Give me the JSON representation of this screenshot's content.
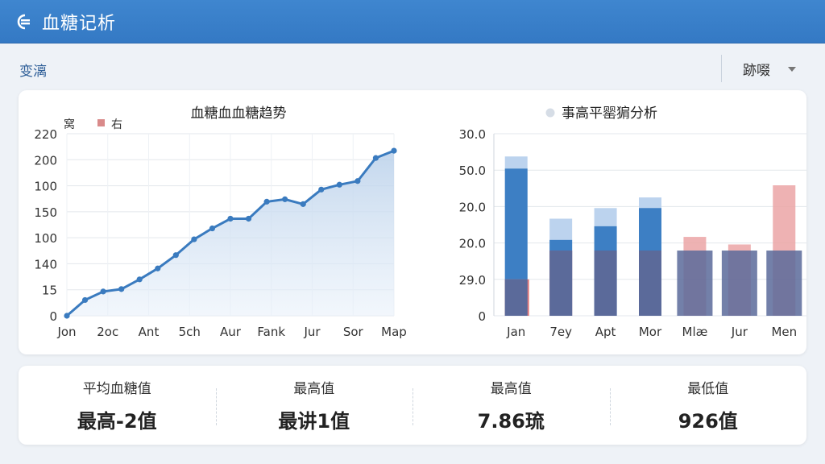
{
  "app": {
    "title": "血糖记析"
  },
  "toolbar": {
    "left_label": "变漓",
    "dropdown_label": "跡啜"
  },
  "charts": {
    "line": {
      "title": "血糖血血糖趋势",
      "legend_left": "窝",
      "legend_right": "右"
    },
    "bar": {
      "title": "事高平罂猏分析"
    }
  },
  "stats": [
    {
      "label": "平均血糖值",
      "value": "最高-2值"
    },
    {
      "label": "最高值",
      "value": "最讲1值"
    },
    {
      "label": "最高值",
      "value": "7.86琉"
    },
    {
      "label": "最低值",
      "value": "926值"
    }
  ],
  "colors": {
    "header": "#3a80c9",
    "line": "#3a7bbf",
    "bar_blue": "#3d7fc4",
    "bar_light_blue": "#bcd3ee",
    "bar_navy": "#5b6a9a",
    "bar_red": "#e07b7d",
    "bar_light_red": "#eba4a6"
  },
  "chart_data": [
    {
      "type": "area",
      "title": "血糖血血糖趋势",
      "categories": [
        "Jon",
        "2oc",
        "Ant",
        "5ch",
        "Aur",
        "Fank",
        "Jur",
        "Sor",
        "Map"
      ],
      "y_ticks": [
        "220",
        "200",
        "100",
        "150",
        "100",
        "140",
        "15",
        "0"
      ],
      "legend": [
        "窝",
        "右"
      ],
      "values": [
        0,
        0.13,
        0.2,
        0.22,
        0.3,
        0.39,
        0.5,
        0.63,
        0.72,
        0.8,
        0.8,
        0.94,
        0.96,
        0.92,
        1.04,
        1.08,
        1.11,
        1.3,
        1.36
      ],
      "grid": true
    },
    {
      "type": "bar",
      "title": "事高平罂猏分析",
      "categories": [
        "Jan",
        "7ey",
        "Apt",
        "Mor",
        "Mlæ",
        "Jur",
        "Men"
      ],
      "y_ticks": [
        "30.0",
        "50.0",
        "20.0",
        "20.0",
        "29.0",
        "0"
      ],
      "series": [
        {
          "values": [
            0,
            0,
            0,
            0,
            0.43,
            0.43,
            0.43
          ]
        },
        {
          "values": [
            0.97,
            0.5,
            0.59,
            0.71,
            0,
            0,
            0
          ]
        },
        {
          "values": [
            1.05,
            0.64,
            0.71,
            0.78,
            0,
            0,
            0
          ]
        },
        {
          "values": [
            0.24,
            0.43,
            0.43,
            0.43,
            0,
            0,
            0
          ]
        },
        {
          "values": [
            0,
            0,
            0,
            0,
            0.52,
            0.47,
            0.86
          ]
        },
        {
          "values": [
            0.24,
            0.43,
            0,
            0,
            0,
            0,
            0
          ]
        }
      ]
    }
  ]
}
